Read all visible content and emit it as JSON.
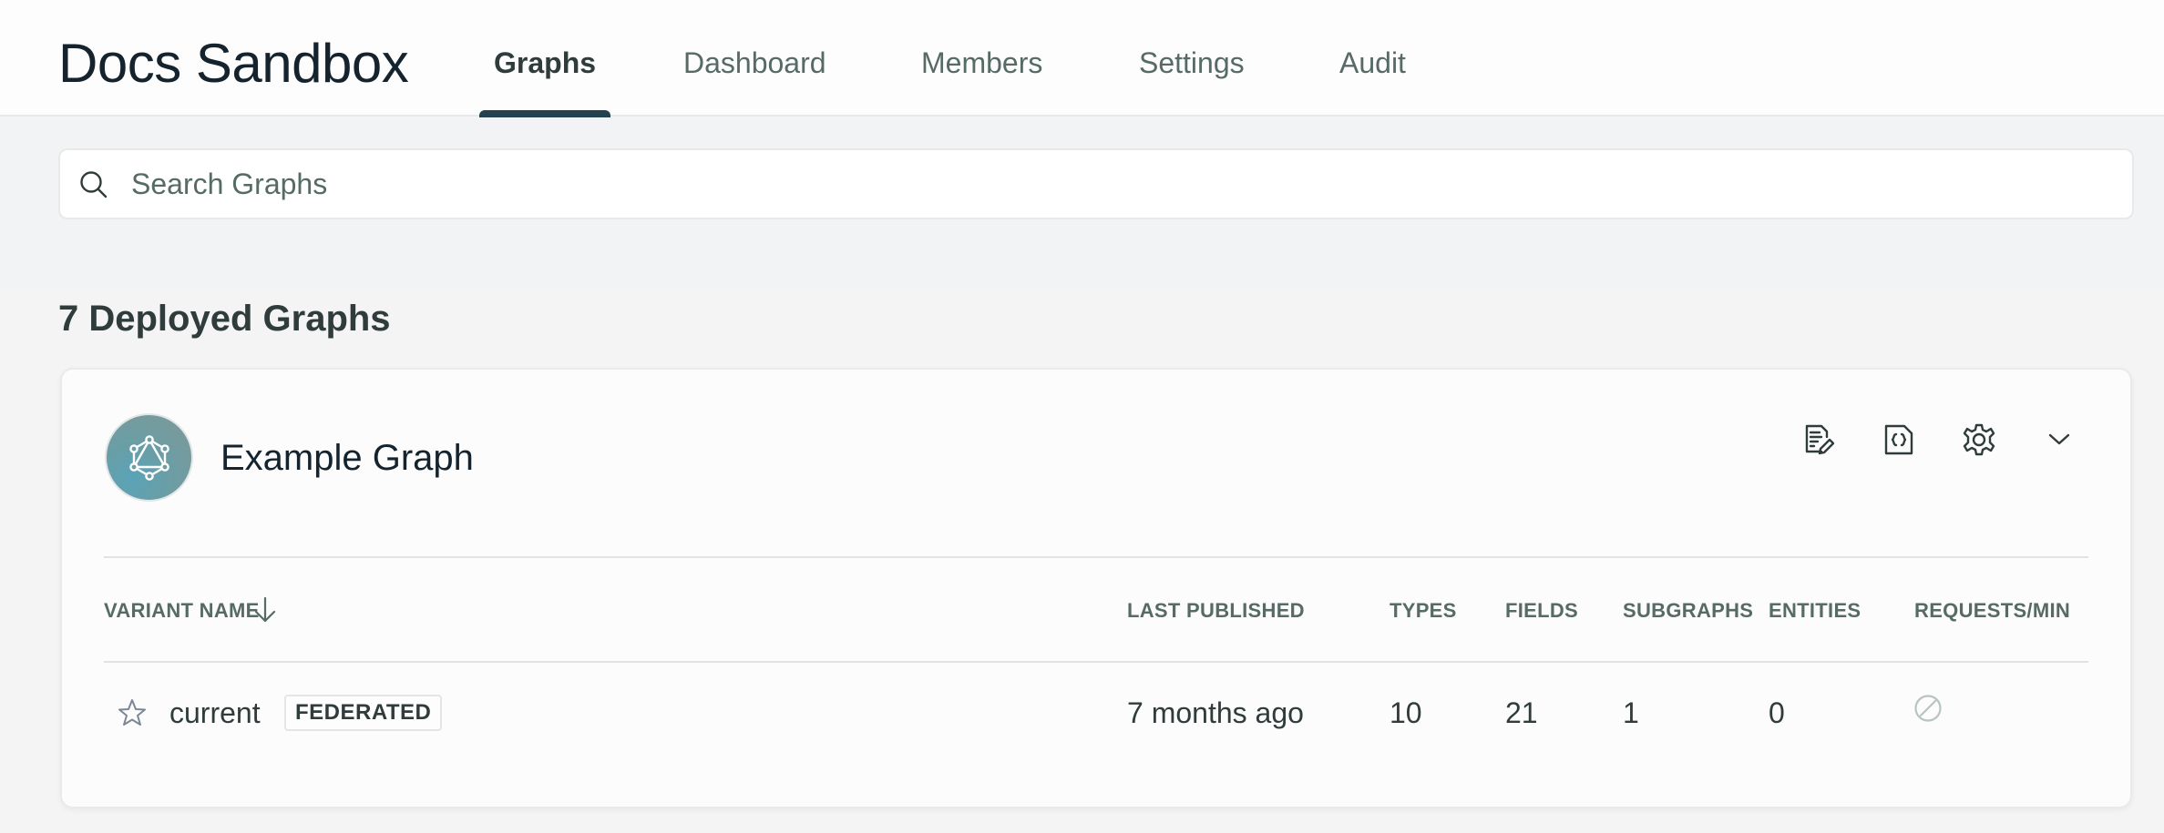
{
  "header": {
    "org_title": "Docs Sandbox",
    "tabs": [
      {
        "label": "Graphs",
        "active": true
      },
      {
        "label": "Dashboard",
        "active": false
      },
      {
        "label": "Members",
        "active": false
      },
      {
        "label": "Settings",
        "active": false
      },
      {
        "label": "Audit",
        "active": false
      }
    ]
  },
  "search": {
    "placeholder": "Search Graphs",
    "value": "",
    "icon": "search-icon"
  },
  "section": {
    "title": "7 Deployed Graphs"
  },
  "graph_card": {
    "name": "Example Graph",
    "avatar_icon": "graphql-logo-icon",
    "actions": [
      {
        "name": "edit-readme",
        "icon": "document-edit-icon"
      },
      {
        "name": "schema",
        "icon": "schema-braces-icon"
      },
      {
        "name": "settings",
        "icon": "gear-icon"
      },
      {
        "name": "expand",
        "icon": "chevron-down-icon"
      }
    ],
    "table": {
      "columns": [
        "VARIANT NAME",
        "LAST PUBLISHED",
        "TYPES",
        "FIELDS",
        "SUBGRAPHS",
        "ENTITIES",
        "REQUESTS/MIN"
      ],
      "sort": {
        "column": "VARIANT NAME",
        "direction": "descending",
        "icon": "arrow-down-icon"
      },
      "rows": [
        {
          "favorite": false,
          "variant": "current",
          "badge": "FEDERATED",
          "last_published": "7 months ago",
          "types": "10",
          "fields": "21",
          "subgraphs": "1",
          "entities": "0",
          "requests_per_min": "unavailable",
          "requests_icon": "no-data-icon"
        }
      ]
    }
  },
  "colors": {
    "accent": "#22424f",
    "text_primary": "#14232d",
    "text_secondary": "#566a66",
    "page_bg": "#f4f4f4"
  }
}
